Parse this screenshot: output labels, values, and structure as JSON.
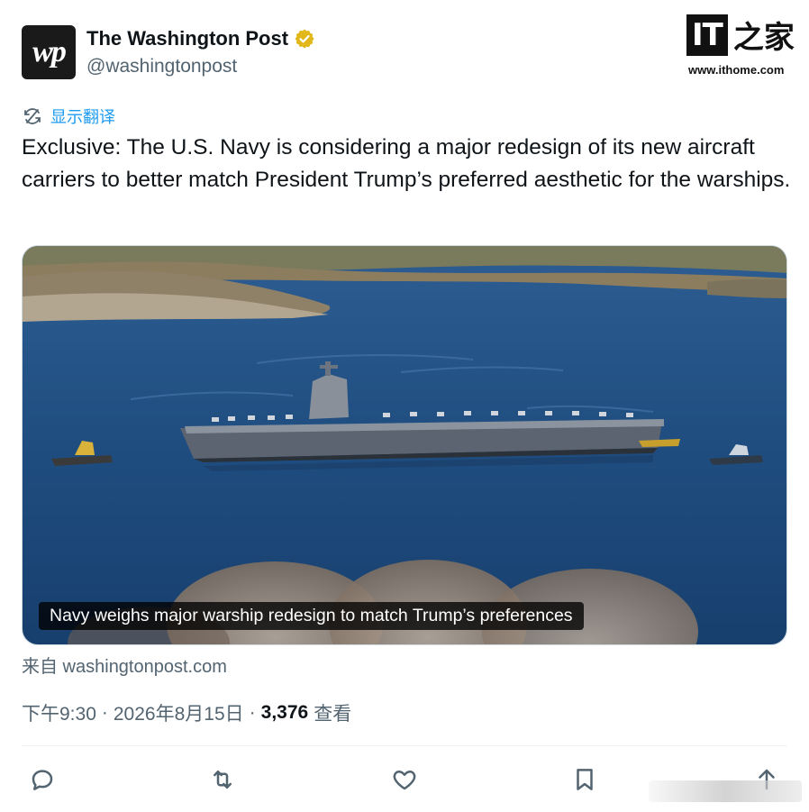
{
  "account": {
    "display_name": "The Washington Post",
    "handle": "@washingtonpost",
    "avatar_text": "wp",
    "verified_badge": "gold-check-icon"
  },
  "watermark": {
    "logo_it": "IT",
    "logo_cn": "之家",
    "url": "www.ithome.com"
  },
  "translate_label": "显示翻译",
  "tweet_text": "Exclusive: The U.S. Navy is considering a major redesign of its new aircraft carriers to better match President Trump’s preferred aesthetic for the warships.",
  "media": {
    "caption": "Navy weighs major warship redesign to match Trump’s preferences"
  },
  "source": "来自 washingtonpost.com",
  "meta": {
    "time": "下午9:30",
    "sep1": "·",
    "date": "2026年8月15日",
    "sep2": "·",
    "views_count": "3,376",
    "views_label": "查看"
  },
  "actions": [
    "reply-icon",
    "retweet-icon",
    "like-icon",
    "bookmark-icon",
    "share-icon"
  ],
  "colors": {
    "link_blue": "#1d9bf0",
    "secondary_text": "#536471",
    "primary_text": "#0f1419",
    "verified_gold": "#e2b719"
  }
}
